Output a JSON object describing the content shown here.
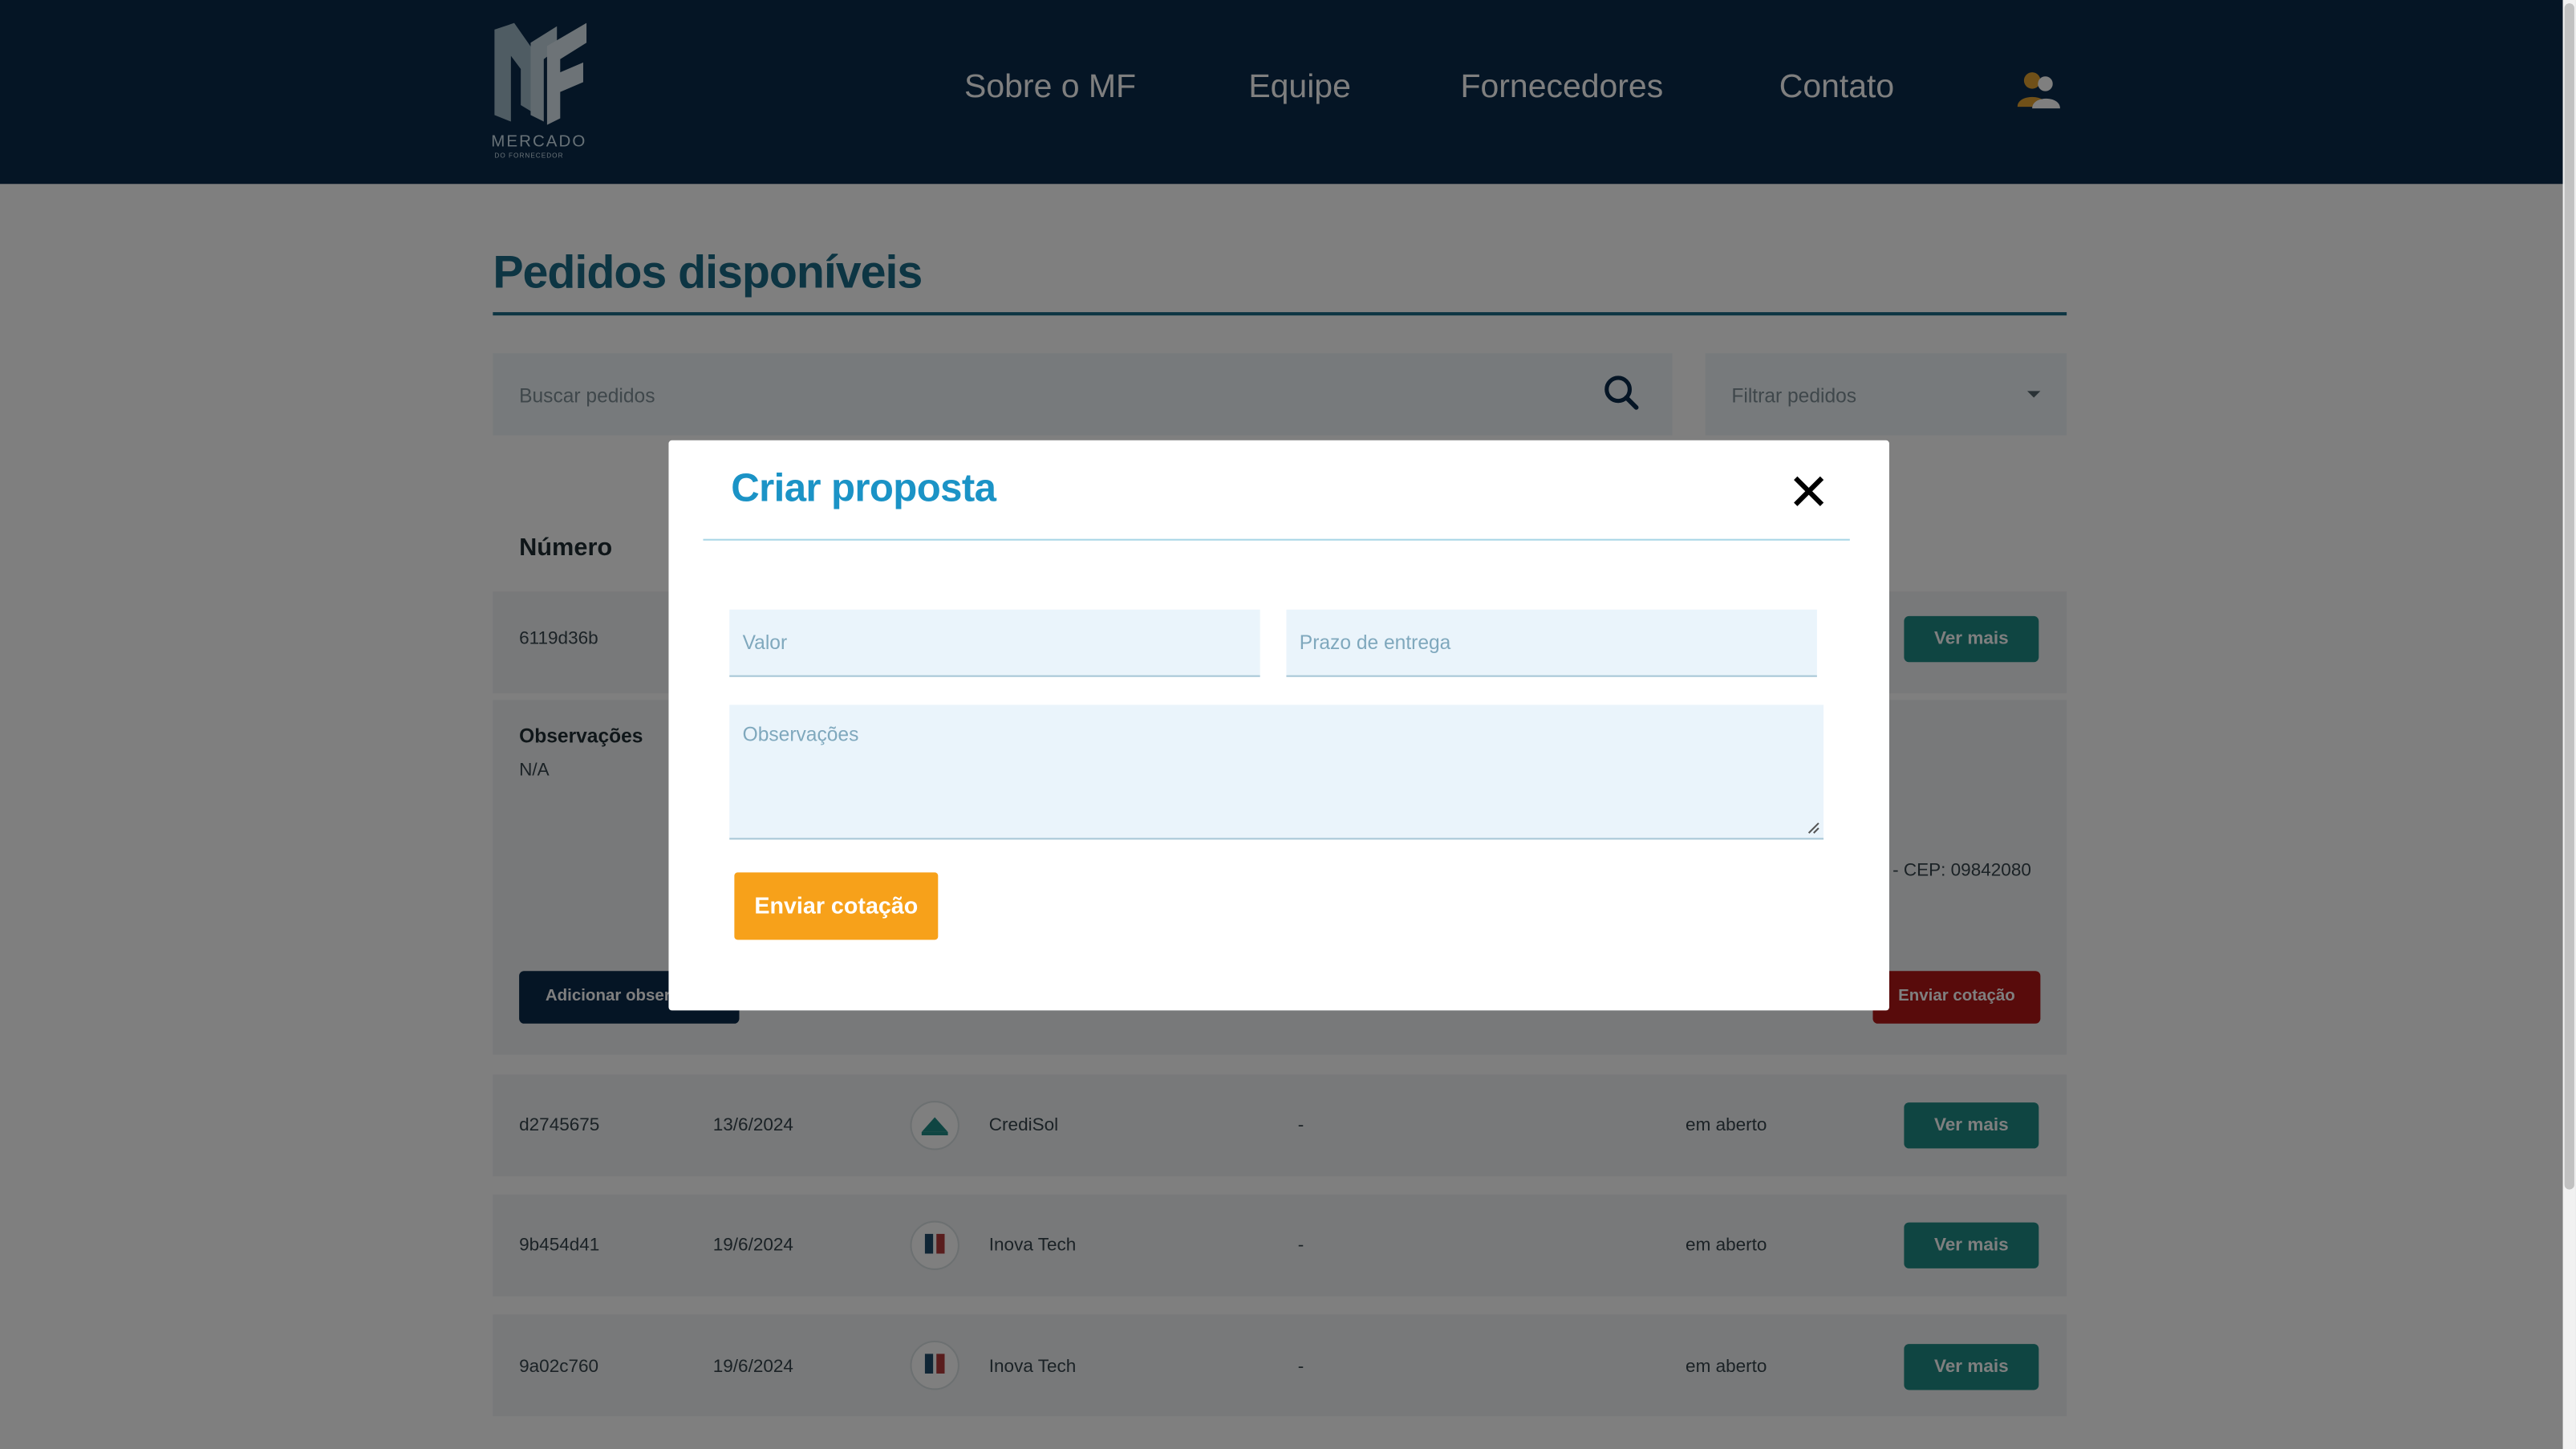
{
  "brand": {
    "name": "MERCADO",
    "sub": "DO FORNECEDOR"
  },
  "nav": {
    "items": [
      "Sobre o MF",
      "Equipe",
      "Fornecedores",
      "Contato"
    ]
  },
  "page": {
    "title": "Pedidos disponíveis"
  },
  "search": {
    "placeholder": "Buscar pedidos"
  },
  "filter": {
    "placeholder": "Filtrar pedidos"
  },
  "table": {
    "header_number": "Número"
  },
  "rows": [
    {
      "id": "6119d36b",
      "button": "Ver mais"
    },
    {
      "id": "d2745675",
      "date": "13/6/2024",
      "company": "CrediSol",
      "value": "-",
      "status": "em aberto",
      "button": "Ver mais"
    },
    {
      "id": "9b454d41",
      "date": "19/6/2024",
      "company": "Inova Tech",
      "value": "-",
      "status": "em aberto",
      "button": "Ver mais"
    },
    {
      "id": "9a02c760",
      "date": "19/6/2024",
      "company": "Inova Tech",
      "value": "-",
      "status": "em aberto",
      "button": "Ver mais"
    }
  ],
  "expanded": {
    "obs_label": "Observações",
    "obs_value": "N/A",
    "cep": "- CEP: 09842080",
    "add_obs_button": "Adicionar observação",
    "send_button": "Enviar cotação"
  },
  "modal": {
    "title": "Criar proposta",
    "valor_placeholder": "Valor",
    "prazo_placeholder": "Prazo de entrega",
    "obs_placeholder": "Observações",
    "send_button": "Enviar cotação"
  },
  "colors": {
    "header": "#0b2a4a",
    "accent": "#1b93c6",
    "orange": "#f7a11a",
    "teal": "#1f8a84"
  }
}
